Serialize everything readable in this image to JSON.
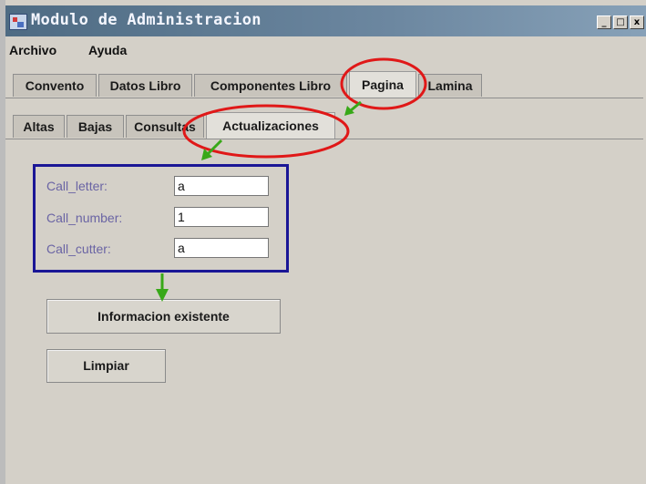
{
  "window": {
    "title": "Modulo de Administracion",
    "controls": [
      "_",
      "□",
      "x"
    ]
  },
  "menu": [
    "Archivo",
    "Ayuda"
  ],
  "main_tabs": [
    {
      "label": "Convento",
      "active": false
    },
    {
      "label": "Datos Libro",
      "active": false
    },
    {
      "label": "Componentes Libro",
      "active": false
    },
    {
      "label": "Pagina",
      "active": true
    },
    {
      "label": "Lamina",
      "active": false
    }
  ],
  "sub_tabs": [
    {
      "label": "Altas",
      "active": false
    },
    {
      "label": "Bajas",
      "active": false
    },
    {
      "label": "Consultas",
      "active": false
    },
    {
      "label": "Actualizaciones",
      "active": true
    }
  ],
  "fields": [
    {
      "label": "Call_letter:",
      "value": "a"
    },
    {
      "label": "Call_number:",
      "value": "1"
    },
    {
      "label": "Call_cutter:",
      "value": "a"
    }
  ],
  "buttons": {
    "info": "Informacion existente",
    "clear": "Limpiar"
  },
  "annotation_colors": {
    "ellipse": "#e01818",
    "arrow": "#38a818",
    "highlight_box": "#1a1696"
  }
}
